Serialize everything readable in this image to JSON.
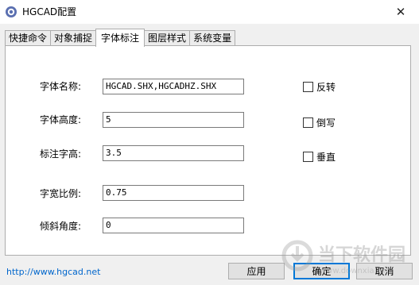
{
  "window": {
    "title": "HGCAD配置",
    "close_symbol": "✕"
  },
  "tabs": [
    {
      "label": "快捷命令",
      "active": false
    },
    {
      "label": "对象捕捉",
      "active": false
    },
    {
      "label": "字体标注",
      "active": true
    },
    {
      "label": "图层样式",
      "active": false
    },
    {
      "label": "系统变量",
      "active": false
    }
  ],
  "form": {
    "font_name": {
      "label": "字体名称:",
      "value": "HGCAD.SHX,HGCADHZ.SHX"
    },
    "font_height": {
      "label": "字体高度:",
      "value": "5"
    },
    "dim_text_height": {
      "label": "标注字高:",
      "value": "3.5"
    },
    "width_ratio": {
      "label": "字宽比例:",
      "value": "0.75"
    },
    "oblique_angle": {
      "label": "倾斜角度:",
      "value": "0"
    }
  },
  "checkboxes": [
    {
      "label": "反转",
      "checked": false
    },
    {
      "label": "倒写",
      "checked": false
    },
    {
      "label": "垂直",
      "checked": false
    }
  ],
  "footer": {
    "link": "http://www.hgcad.net",
    "apply_label": "应用",
    "ok_label": "确定",
    "cancel_label": "取消"
  },
  "watermark": {
    "text": "当下软件园",
    "url": "www.downxia.com"
  },
  "colors": {
    "link": "#0066cc",
    "default_button_border": "#0078d7"
  }
}
